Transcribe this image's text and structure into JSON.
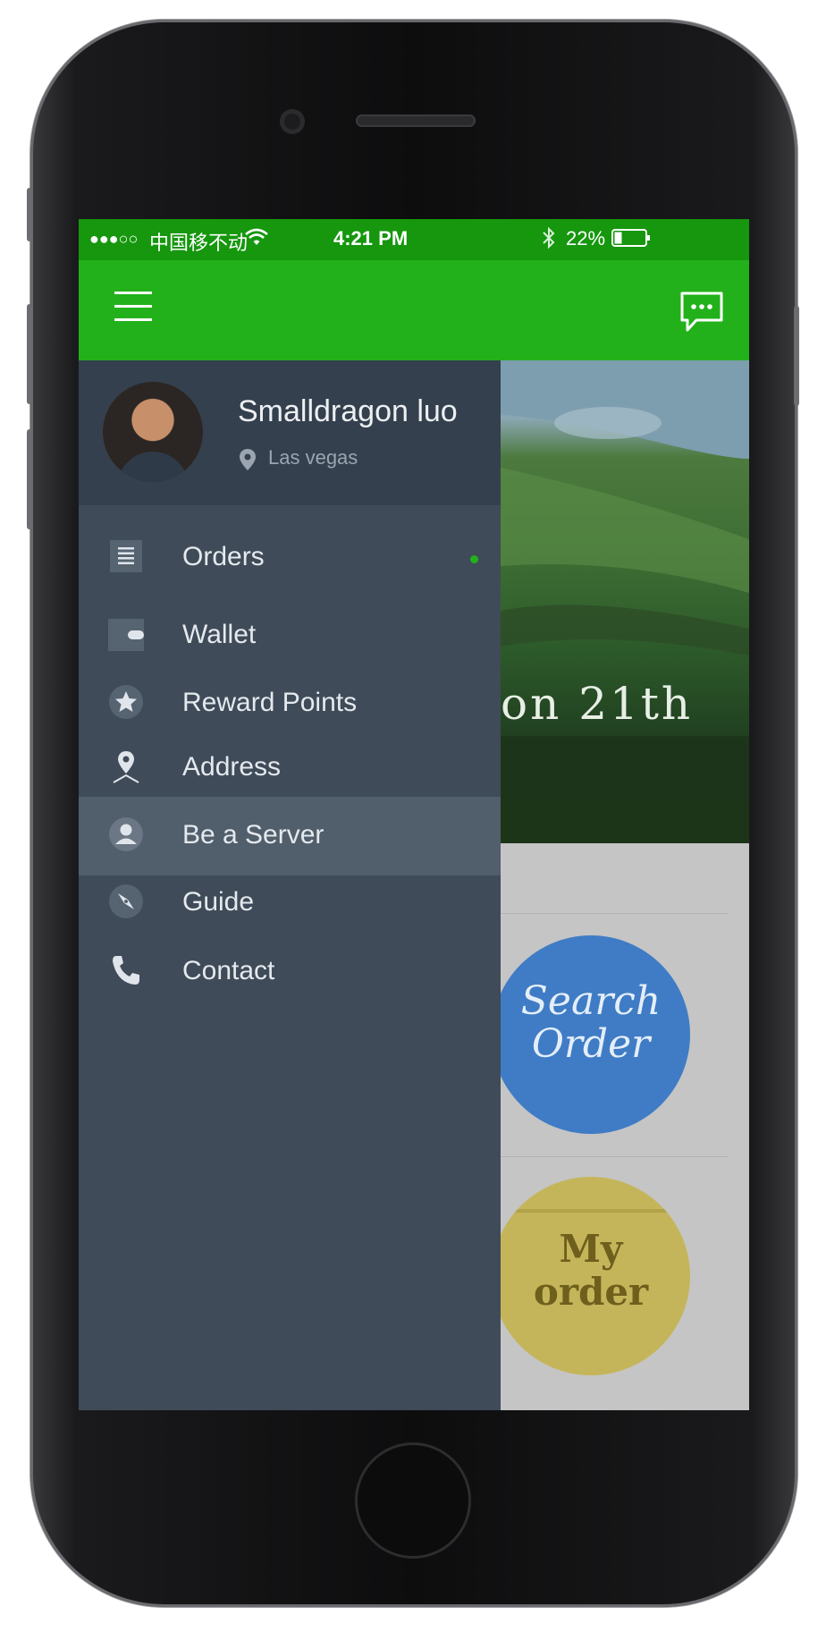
{
  "status_bar": {
    "signal": "●●●○○",
    "carrier": "中国移不动",
    "time": "4:21 PM",
    "battery_percent": "22%",
    "battery_level": 0.22
  },
  "app_bar": {
    "menu_icon": "hamburger-menu-icon",
    "chat_icon": "chat-bubble-icon"
  },
  "profile": {
    "name": "Smalldragon luo",
    "location": "Las vegas"
  },
  "drawer": {
    "items": [
      {
        "label": "Orders",
        "icon": "orders-list-icon",
        "badge": true
      },
      {
        "label": "Wallet",
        "icon": "wallet-icon"
      },
      {
        "label": "Reward Points",
        "icon": "star-icon"
      },
      {
        "label": "Address",
        "icon": "location-pin-icon"
      },
      {
        "label": "Be a Server",
        "icon": "user-icon",
        "active": true
      },
      {
        "label": "Guide",
        "icon": "compass-icon"
      },
      {
        "label": "Contact",
        "icon": "phone-icon"
      }
    ]
  },
  "background": {
    "hero_text": "on 21th",
    "circle_1_line1": "Search",
    "circle_1_line2": "Order",
    "circle_2_line1": "My",
    "circle_2_line2": "order"
  },
  "colors": {
    "status_bar": "#16970e",
    "app_bar": "#22b11b",
    "drawer": "#3f4b58",
    "drawer_header": "#34404d",
    "drawer_active": "#515e6b",
    "badge": "#22b11b"
  }
}
